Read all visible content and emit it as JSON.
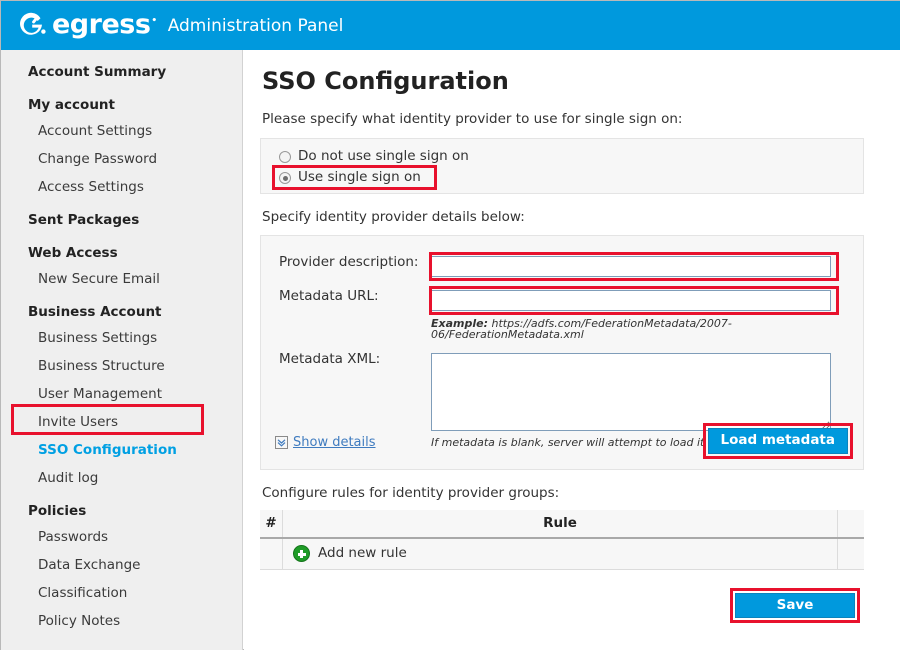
{
  "header": {
    "logo_icon": "egress-logo-icon",
    "brand": "egress",
    "trademark": "®",
    "title": "Administration Panel",
    "background_color": "#0099dd"
  },
  "sidebar": {
    "items": [
      {
        "label": "Account Summary",
        "type": "group"
      },
      {
        "label": "My account",
        "type": "group"
      },
      {
        "label": "Account Settings",
        "type": "child"
      },
      {
        "label": "Change Password",
        "type": "child"
      },
      {
        "label": "Access Settings",
        "type": "child"
      },
      {
        "label": "Sent Packages",
        "type": "group"
      },
      {
        "label": "Web Access",
        "type": "group"
      },
      {
        "label": "New Secure Email",
        "type": "child"
      },
      {
        "label": "Business Account",
        "type": "group"
      },
      {
        "label": "Business Settings",
        "type": "child"
      },
      {
        "label": "Business Structure",
        "type": "child"
      },
      {
        "label": "User Management",
        "type": "child"
      },
      {
        "label": "Invite Users",
        "type": "child"
      },
      {
        "label": "SSO Configuration",
        "type": "child",
        "active": true
      },
      {
        "label": "Audit log",
        "type": "child"
      },
      {
        "label": "Policies",
        "type": "group"
      },
      {
        "label": "Passwords",
        "type": "child"
      },
      {
        "label": "Data Exchange",
        "type": "child"
      },
      {
        "label": "Classification",
        "type": "child"
      },
      {
        "label": "Policy Notes",
        "type": "child"
      }
    ],
    "active_color": "#00a0e3",
    "highlight_color": "#e8112d"
  },
  "main": {
    "page_title": "SSO Configuration",
    "intro_text": "Please specify what identity provider to use for single sign on:",
    "sso_mode": {
      "options": [
        {
          "label": "Do not use single sign on",
          "selected": false
        },
        {
          "label": "Use single sign on",
          "selected": true
        }
      ]
    },
    "details": {
      "section_label": "Specify identity provider details below:",
      "provider_description": {
        "label": "Provider description:",
        "value": "",
        "placeholder": ""
      },
      "metadata_url": {
        "label": "Metadata URL:",
        "value": "",
        "placeholder": ""
      },
      "url_example_prefix": "Example:",
      "url_example": " https://adfs.com/FederationMetadata/2007-06/FederationMetadata.xml",
      "metadata_xml": {
        "label": "Metadata XML:",
        "value": "",
        "placeholder": ""
      },
      "xml_hint": "If metadata is blank, server will attempt to load it from the URL.",
      "show_details_label": "Show details",
      "show_details_icon": "chevron-double-down-icon",
      "load_metadata_label": "Load metadata"
    },
    "rules": {
      "intro": "Configure rules for identity provider groups:",
      "columns": [
        "#",
        "Rule",
        ""
      ],
      "add_row_label": "Add new rule",
      "add_row_icon": "plus-circle-icon",
      "rows": []
    },
    "save_label": "Save"
  }
}
